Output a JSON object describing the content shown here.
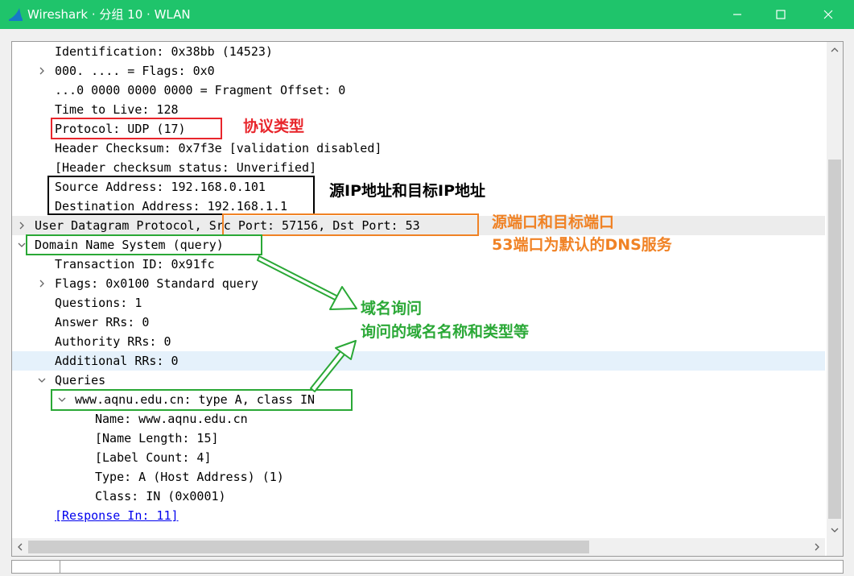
{
  "window": {
    "title": "Wireshark · 分组 10 · WLAN",
    "controls": [
      "minimize",
      "maximize",
      "close"
    ],
    "titlebar_color": "#1fc46b"
  },
  "packet_tree": {
    "rows": [
      {
        "text": "Identification: 0x38bb (14523)"
      },
      {
        "text": "000. .... = Flags: 0x0",
        "expander": "collapsed"
      },
      {
        "text": "...0 0000 0000 0000 = Fragment Offset: 0"
      },
      {
        "text": "Time to Live: 128"
      },
      {
        "text": "Protocol: UDP (17)"
      },
      {
        "text": "Header Checksum: 0x7f3e [validation disabled]"
      },
      {
        "text": "[Header checksum status: Unverified]"
      },
      {
        "text": "Source Address: 192.168.0.101"
      },
      {
        "text": "Destination Address: 192.168.1.1"
      },
      {
        "text": "User Datagram Protocol, Src Port: 57156, Dst Port: 53",
        "expander": "collapsed"
      },
      {
        "text": "Domain Name System (query)",
        "expander": "expanded"
      },
      {
        "text": "Transaction ID: 0x91fc"
      },
      {
        "text": "Flags: 0x0100 Standard query",
        "expander": "collapsed"
      },
      {
        "text": "Questions: 1"
      },
      {
        "text": "Answer RRs: 0"
      },
      {
        "text": "Authority RRs: 0"
      },
      {
        "text": "Additional RRs: 0",
        "selected": true
      },
      {
        "text": "Queries",
        "expander": "expanded"
      },
      {
        "text": "www.aqnu.edu.cn: type A, class IN",
        "expander": "expanded"
      },
      {
        "text": "Name: www.aqnu.edu.cn"
      },
      {
        "text": "[Name Length: 15]"
      },
      {
        "text": "[Label Count: 4]"
      },
      {
        "text": "Type: A (Host Address) (1)"
      },
      {
        "text": "Class: IN (0x0001)"
      },
      {
        "text": "[Response In: 11]",
        "link": true
      }
    ]
  },
  "annotations": {
    "protocol_type": {
      "text": "协议类型",
      "color": "#e8262c"
    },
    "ip_addresses": {
      "text": "源IP地址和目标IP地址",
      "color": "#000000"
    },
    "ports_line1": {
      "text": "源端口和目标端口",
      "color": "#f08225"
    },
    "ports_line2": {
      "text": "53端口为默认的DNS服务",
      "color": "#f08225"
    },
    "dns_line1": {
      "text": "域名询问",
      "color": "#2aa836"
    },
    "dns_line2": {
      "text": "询问的域名名称和类型等",
      "color": "#2aa836"
    }
  },
  "colors": {
    "selected_row": "#e5f1fb",
    "protocol_row": "#ececec",
    "link": "#0000ee"
  }
}
